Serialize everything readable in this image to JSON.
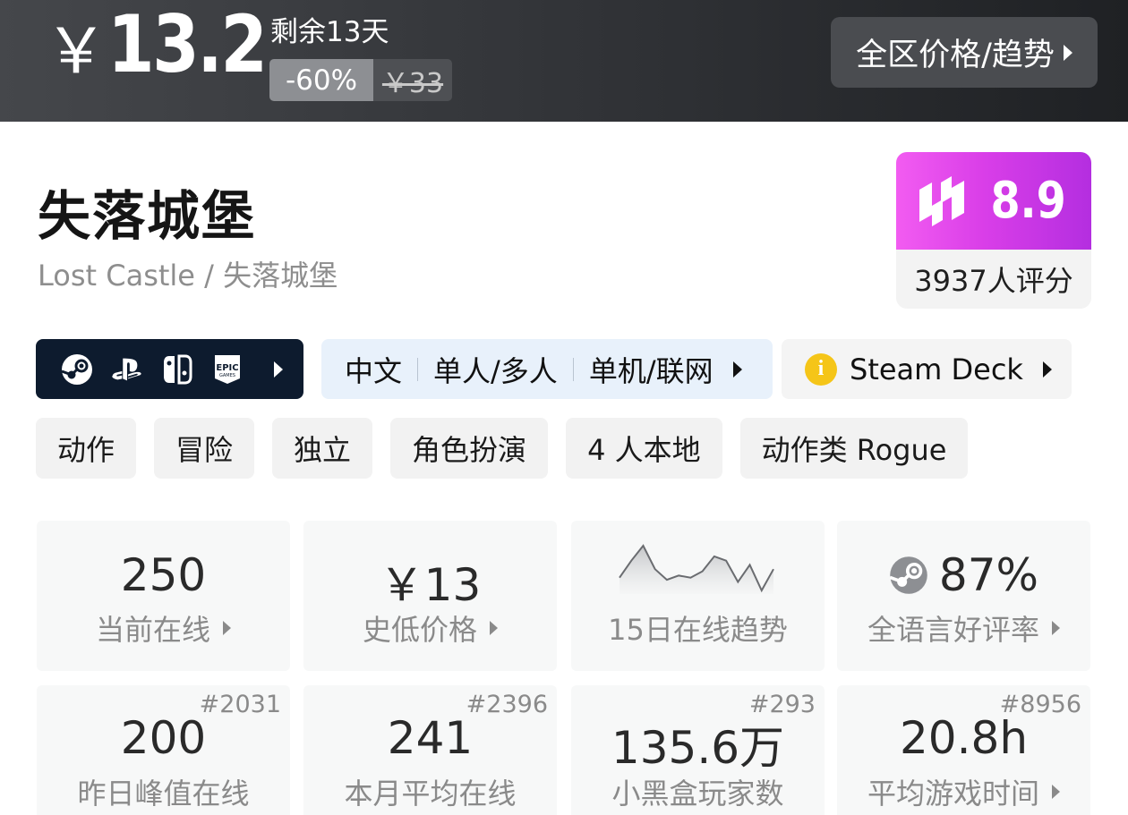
{
  "price": {
    "currency": "￥",
    "current": "13.2",
    "remaining": "剩余13天",
    "discount": "-60%",
    "original": "￥33",
    "region_button": "全区价格/趋势"
  },
  "game": {
    "title": "失落城堡",
    "subtitle": "Lost Castle / 失落城堡"
  },
  "score": {
    "value": "8.9",
    "count": "3937人评分",
    "gradient_colors": [
      "#f25cf1",
      "#b42ee0"
    ]
  },
  "platforms": {
    "icons": [
      "steam-icon",
      "playstation-icon",
      "switch-icon",
      "epic-games-icon"
    ]
  },
  "features": {
    "items": [
      "中文",
      "单人/多人",
      "单机/联网"
    ]
  },
  "steam_deck": {
    "label": "Steam Deck",
    "status_icon": "info-icon",
    "status_color": "#f5c518"
  },
  "tags": [
    "动作",
    "冒险",
    "独立",
    "角色扮演",
    "4 人本地",
    "动作类 Rogue"
  ],
  "stats": {
    "online": {
      "value": "250",
      "label": "当前在线"
    },
    "lowest_price": {
      "value": "￥13",
      "label": "史低价格"
    },
    "trend": {
      "label": "15日在线趋势",
      "values": [
        10,
        18,
        25,
        14,
        9,
        11,
        10,
        13,
        20,
        18,
        8,
        16,
        4,
        14
      ]
    },
    "rating": {
      "value": "87%",
      "label": "全语言好评率"
    },
    "yesterday_peak": {
      "value": "200",
      "label": "昨日峰值在线",
      "rank": "#2031"
    },
    "monthly_avg": {
      "value": "241",
      "label": "本月平均在线",
      "rank": "#2396"
    },
    "players": {
      "value": "135.6万",
      "label": "小黑盒玩家数",
      "rank": "#293"
    },
    "avg_playtime": {
      "value": "20.8h",
      "label": "平均游戏时间",
      "rank": "#8956"
    }
  }
}
